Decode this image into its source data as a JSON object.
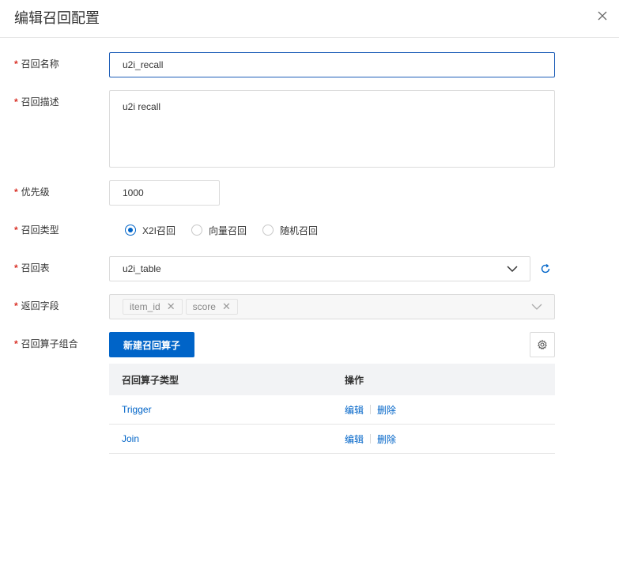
{
  "dialog": {
    "title": "编辑召回配置"
  },
  "form": {
    "name": {
      "label": "召回名称",
      "value": "u2i_recall"
    },
    "desc": {
      "label": "召回描述",
      "value": "u2i recall"
    },
    "priority": {
      "label": "优先级",
      "value": "1000"
    },
    "type": {
      "label": "召回类型",
      "options": [
        "X2I召回",
        "向量召回",
        "随机召回"
      ],
      "selected": "X2I召回"
    },
    "table": {
      "label": "召回表",
      "value": "u2i_table"
    },
    "fields": {
      "label": "返回字段",
      "tags": [
        "item_id",
        "score"
      ]
    },
    "operators": {
      "label": "召回算子组合",
      "new_button": "新建召回算子"
    }
  },
  "op_table": {
    "headers": [
      "召回算子类型",
      "操作"
    ],
    "rows": [
      {
        "type": "Trigger",
        "edit": "编辑",
        "delete": "删除"
      },
      {
        "type": "Join",
        "edit": "编辑",
        "delete": "删除"
      }
    ]
  },
  "colors": {
    "primary": "#0064c8",
    "required": "#d93026"
  }
}
